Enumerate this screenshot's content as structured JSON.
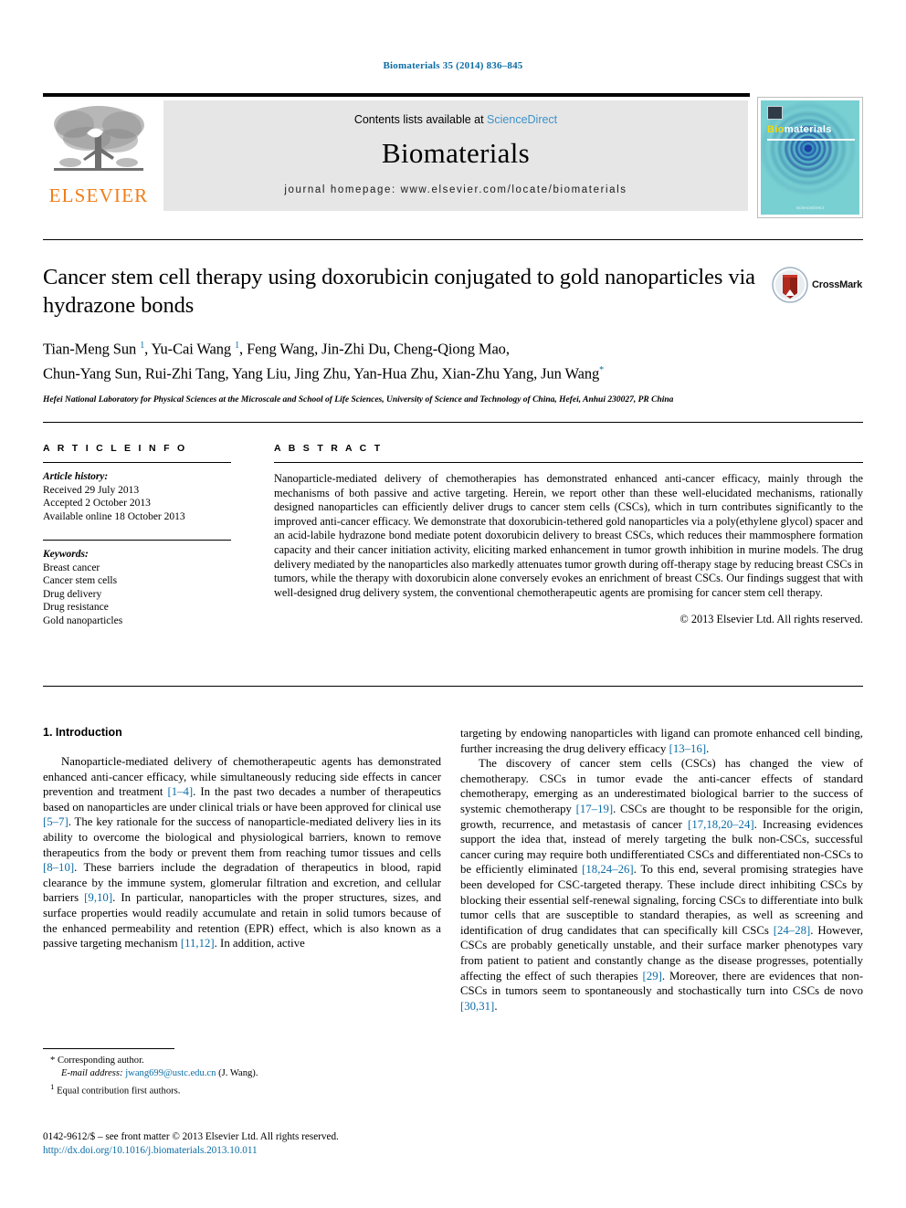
{
  "running_head": "Biomaterials 35 (2014) 836–845",
  "masthead": {
    "contents_prefix": "Contents lists available at ",
    "sciencedirect": "ScienceDirect",
    "journal_name": "Biomaterials",
    "homepage": "journal homepage: www.elsevier.com/locate/biomaterials",
    "publisher_logo_text": "ELSEVIER",
    "cover_title_bio": "Bio",
    "cover_title_rest": "materials",
    "cover_footer": "ScienceDirect"
  },
  "article": {
    "title": "Cancer stem cell therapy using doxorubicin conjugated to gold nanoparticles via hydrazone bonds",
    "authors_line1": "Tian-Meng Sun 1, Yu-Cai Wang 1, Feng Wang, Jin-Zhi Du, Cheng-Qiong Mao,",
    "authors_line2": "Chun-Yang Sun, Rui-Zhi Tang, Yang Liu, Jing Zhu, Yan-Hua Zhu, Xian-Zhu Yang, Jun Wang*",
    "affiliation": "Hefei National Laboratory for Physical Sciences at the Microscale and School of Life Sciences, University of Science and Technology of China, Hefei, Anhui 230027, PR China",
    "crossmark_label": "CrossMark"
  },
  "article_info": {
    "heading": "A R T I C L E   I N F O",
    "history_label": "Article history:",
    "history": [
      "Received 29 July 2013",
      "Accepted 2 October 2013",
      "Available online 18 October 2013"
    ],
    "keywords_label": "Keywords:",
    "keywords": [
      "Breast cancer",
      "Cancer stem cells",
      "Drug delivery",
      "Drug resistance",
      "Gold nanoparticles"
    ]
  },
  "abstract": {
    "heading": "A B S T R A C T",
    "text": "Nanoparticle-mediated delivery of chemotherapies has demonstrated enhanced anti-cancer efficacy, mainly through the mechanisms of both passive and active targeting. Herein, we report other than these well-elucidated mechanisms, rationally designed nanoparticles can efficiently deliver drugs to cancer stem cells (CSCs), which in turn contributes significantly to the improved anti-cancer efficacy. We demonstrate that doxorubicin-tethered gold nanoparticles via a poly(ethylene glycol) spacer and an acid-labile hydrazone bond mediate potent doxorubicin delivery to breast CSCs, which reduces their mammosphere formation capacity and their cancer initiation activity, eliciting marked enhancement in tumor growth inhibition in murine models. The drug delivery mediated by the nanoparticles also markedly attenuates tumor growth during off-therapy stage by reducing breast CSCs in tumors, while the therapy with doxorubicin alone conversely evokes an enrichment of breast CSCs. Our findings suggest that with well-designed drug delivery system, the conventional chemotherapeutic agents are promising for cancer stem cell therapy.",
    "copyright": "© 2013 Elsevier Ltd. All rights reserved."
  },
  "introduction": {
    "heading": "1. Introduction",
    "left_p1_a": "Nanoparticle-mediated delivery of chemotherapeutic agents has demonstrated enhanced anti-cancer efficacy, while simultaneously reducing side effects in cancer prevention and treatment ",
    "ref_1_4": "[1–4]",
    "left_p1_b": ". In the past two decades a number of therapeutics based on nanoparticles are under clinical trials or have been approved for clinical use ",
    "ref_5_7": "[5–7]",
    "left_p1_c": ". The key rationale for the success of nanoparticle-mediated delivery lies in its ability to overcome the biological and physiological barriers, known to remove therapeutics from the body or prevent them from reaching tumor tissues and cells ",
    "ref_8_10": "[8–10]",
    "left_p1_d": ". These barriers include the degradation of therapeutics in blood, rapid clearance by the immune system, glomerular filtration and excretion, and cellular barriers ",
    "ref_9_10": "[9,10]",
    "left_p1_e": ". In particular, nanoparticles with the proper structures, sizes, and surface properties would readily accumulate and retain in solid tumors because of the enhanced permeability and retention (EPR) effect, which is also known as a passive targeting mechanism ",
    "ref_11_12": "[11,12]",
    "left_p1_f": ". In addition, active",
    "right_p1_a": "targeting by endowing nanoparticles with ligand can promote enhanced cell binding, further increasing the drug delivery efficacy ",
    "ref_13_16": "[13–16]",
    "right_p1_b": ".",
    "right_p2_a": "The discovery of cancer stem cells (CSCs) has changed the view of chemotherapy. CSCs in tumor evade the anti-cancer effects of standard chemotherapy, emerging as an underestimated biological barrier to the success of systemic chemotherapy ",
    "ref_17_19": "[17–19]",
    "right_p2_b": ". CSCs are thought to be responsible for the origin, growth, recurrence, and metastasis of cancer ",
    "ref_17_24": "[17,18,20–24]",
    "right_p2_c": ". Increasing evidences support the idea that, instead of merely targeting the bulk non-CSCs, successful cancer curing may require both undifferentiated CSCs and differentiated non-CSCs to be efficiently eliminated ",
    "ref_18_26": "[18,24–26]",
    "right_p2_d": ". To this end, several promising strategies have been developed for CSC-targeted therapy. These include direct inhibiting CSCs by blocking their essential self-renewal signaling, forcing CSCs to differentiate into bulk tumor cells that are susceptible to standard therapies, as well as screening and identification of drug candidates that can specifically kill CSCs ",
    "ref_24_28": "[24–28]",
    "right_p2_e": ". However, CSCs are probably genetically unstable, and their surface marker phenotypes vary from patient to patient and constantly change as the disease progresses, potentially affecting the effect of such therapies ",
    "ref_29": "[29]",
    "right_p2_f": ". Moreover, there are evidences that non-CSCs in tumors seem to spontaneously and stochastically turn into CSCs de novo ",
    "ref_30_31": "[30,31]",
    "right_p2_g": "."
  },
  "footnotes": {
    "corresponding": "* Corresponding author.",
    "email_label": "E-mail address:",
    "email": "jwang699@ustc.edu.cn",
    "email_suffix": "(J. Wang).",
    "equal_mark": "1",
    "equal_text": "Equal contribution first authors."
  },
  "imprint": {
    "line1": "0142-9612/$ – see front matter © 2013 Elsevier Ltd. All rights reserved.",
    "doi": "http://dx.doi.org/10.1016/j.biomaterials.2013.10.011"
  },
  "colors": {
    "link_blue": "#0b6ca5",
    "sciencedirect_blue": "#3d92c8",
    "elsevier_orange": "#f07d19",
    "panel_grey": "#e6e6e6"
  }
}
